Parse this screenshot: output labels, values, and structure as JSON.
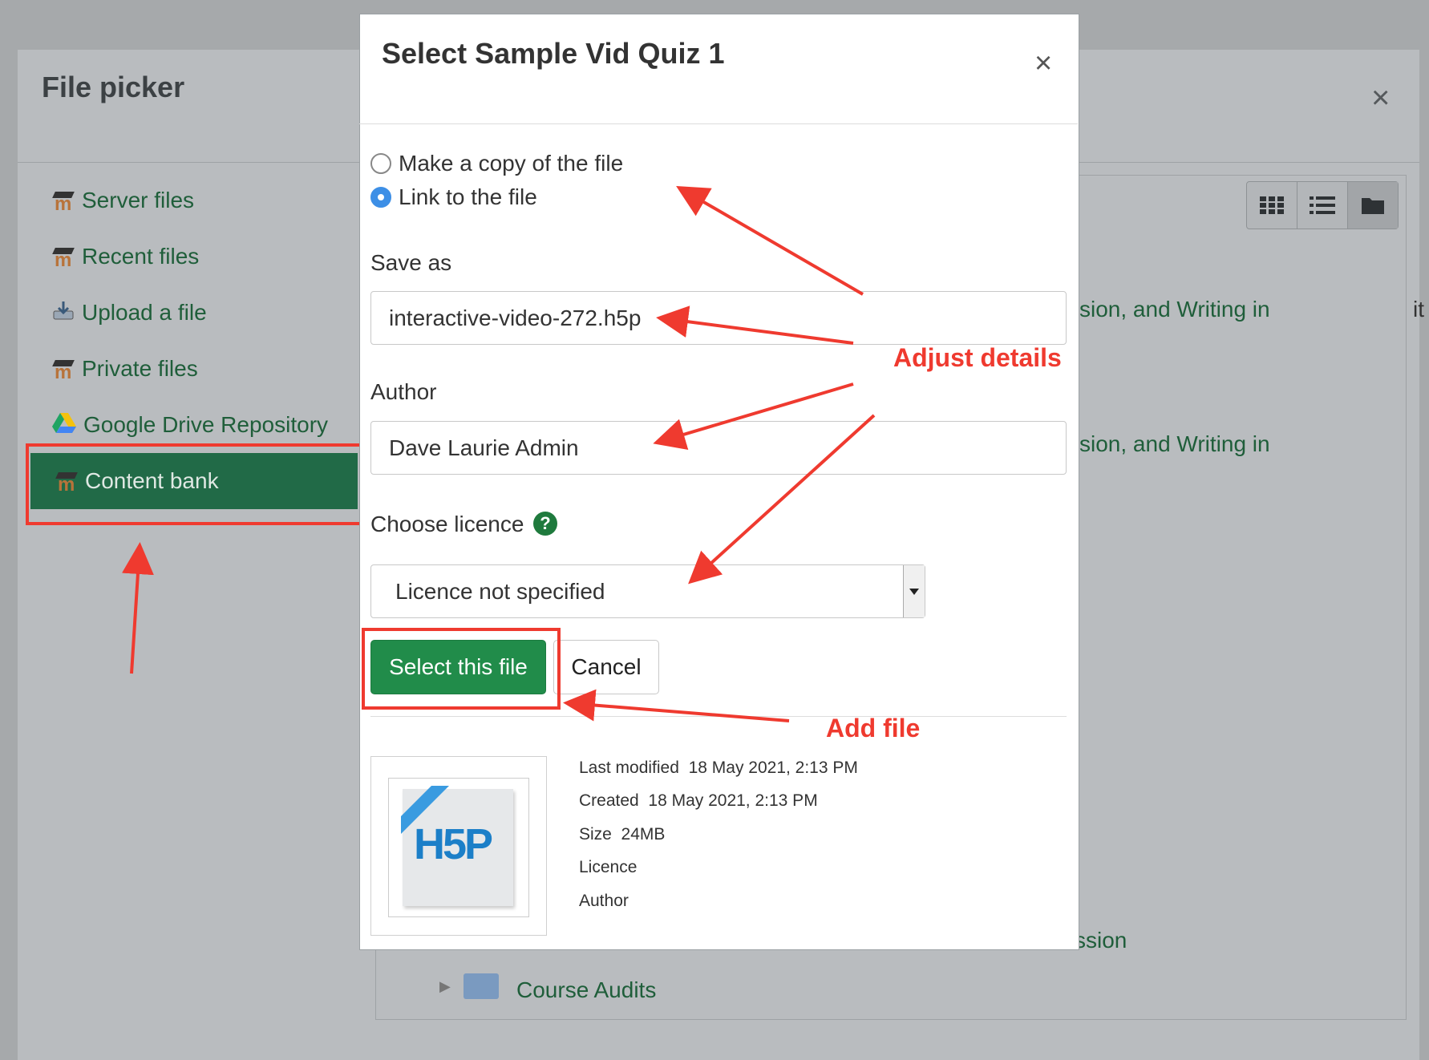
{
  "file_picker": {
    "title": "File picker",
    "close": "×",
    "repositories": [
      {
        "label": "Server files"
      },
      {
        "label": "Recent files"
      },
      {
        "label": "Upload a file"
      },
      {
        "label": "Private files"
      },
      {
        "label": "Google Drive Repository"
      },
      {
        "label": "Content bank",
        "selected": true
      }
    ],
    "background_links": [
      "sion, and Writing in",
      "sion, and Writing in",
      "ssion",
      "Course Audits"
    ],
    "edge_text": "it"
  },
  "dialog": {
    "title": "Select Sample Vid Quiz 1",
    "close": "×",
    "options": [
      {
        "label": "Make a copy of the file",
        "checked": false
      },
      {
        "label": "Link to the file",
        "checked": true
      }
    ],
    "save_as_label": "Save as",
    "save_as_value": "interactive-video-272.h5p",
    "author_label": "Author",
    "author_value": "Dave Laurie Admin",
    "licence_label": "Choose licence",
    "licence_help": "?",
    "licence_value": "Licence not specified",
    "select_button": "Select this file",
    "cancel_button": "Cancel",
    "details": {
      "last_modified_label": "Last modified",
      "last_modified_value": "18 May 2021, 2:13 PM",
      "created_label": "Created",
      "created_value": "18 May 2021, 2:13 PM",
      "size_label": "Size",
      "size_value": "24MB",
      "licence_label": "Licence",
      "author_label": "Author"
    },
    "thumbnail_text": "H5P"
  },
  "annotations": {
    "adjust_details": "Adjust details",
    "add_file": "Add file"
  },
  "colors": {
    "accent_green": "#218c4a",
    "link_green": "#1f5e3a",
    "annotation_red": "#ef3a2f",
    "radio_blue": "#3d8fe6"
  }
}
